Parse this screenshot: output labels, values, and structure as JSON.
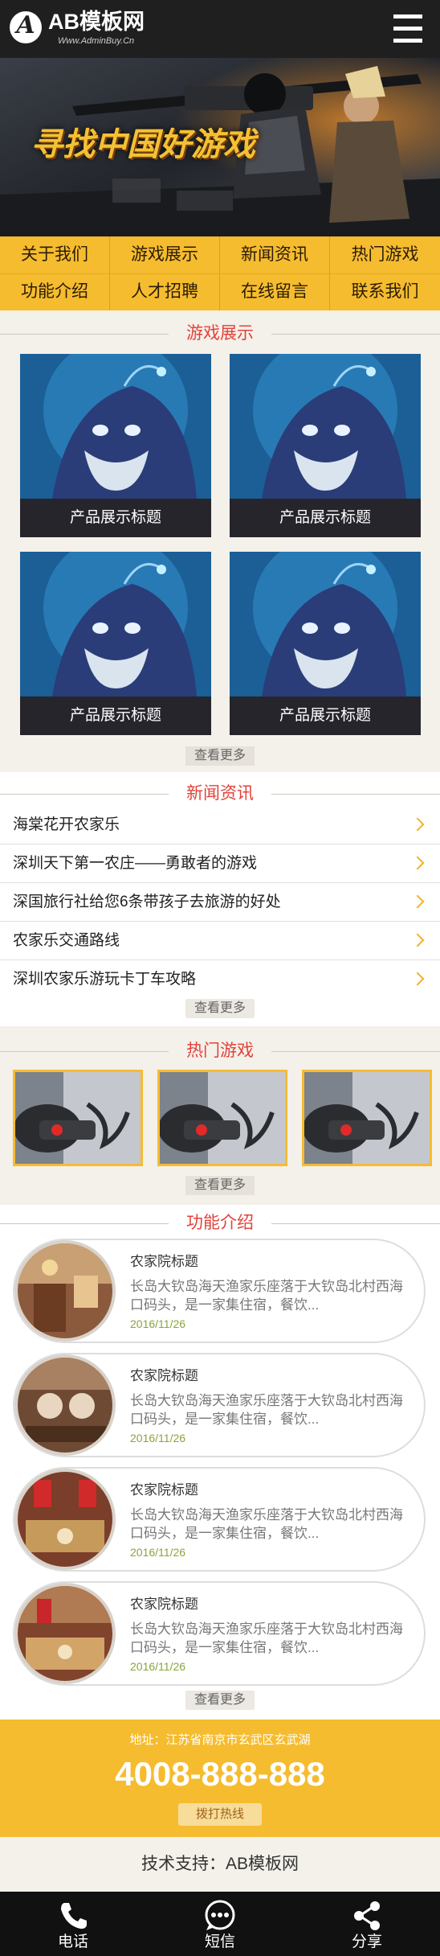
{
  "header": {
    "logo_letter": "A",
    "logo_title": "AB模板网",
    "logo_url": "Www.AdminBuy.Cn",
    "menu_icon": "hamburger-menu-icon"
  },
  "banner": {
    "slogan": "寻找中国好游戏"
  },
  "nav": {
    "items": [
      "关于我们",
      "游戏展示",
      "新闻资讯",
      "热门游戏",
      "功能介绍",
      "人才招聘",
      "在线留言",
      "联系我们"
    ]
  },
  "products": {
    "title": "游戏展示",
    "items": [
      {
        "caption": "产品展示标题"
      },
      {
        "caption": "产品展示标题"
      },
      {
        "caption": "产品展示标题"
      },
      {
        "caption": "产品展示标题"
      }
    ],
    "more": "查看更多"
  },
  "news": {
    "title": "新闻资讯",
    "items": [
      {
        "title": "海棠花开农家乐"
      },
      {
        "title": "深圳天下第一农庄——勇敢者的游戏"
      },
      {
        "title": "深国旅行社给您6条带孩子去旅游的好处"
      },
      {
        "title": "农家乐交通路线"
      },
      {
        "title": "深圳农家乐游玩卡丁车攻略"
      }
    ],
    "more": "查看更多"
  },
  "hot": {
    "title": "热门游戏",
    "more": "查看更多"
  },
  "features": {
    "title": "功能介绍",
    "items": [
      {
        "title": "农家院标题",
        "desc": "长岛大钦岛海天渔家乐座落于大钦岛北村西海口码头，是一家集住宿，餐饮...",
        "date": "2016/11/26"
      },
      {
        "title": "农家院标题",
        "desc": "长岛大钦岛海天渔家乐座落于大钦岛北村西海口码头，是一家集住宿，餐饮...",
        "date": "2016/11/26"
      },
      {
        "title": "农家院标题",
        "desc": "长岛大钦岛海天渔家乐座落于大钦岛北村西海口码头，是一家集住宿，餐饮...",
        "date": "2016/11/26"
      },
      {
        "title": "农家院标题",
        "desc": "长岛大钦岛海天渔家乐座落于大钦岛北村西海口码头，是一家集住宿，餐饮...",
        "date": "2016/11/26"
      }
    ],
    "more": "查看更多"
  },
  "contact": {
    "address": "地址：江苏省南京市玄武区玄武湖",
    "phone": "4008-888-888",
    "hotline_button": "拨打热线"
  },
  "footer": {
    "support": "技术支持：AB模板网"
  },
  "bottom_bar": {
    "items": [
      {
        "label": "电话",
        "icon": "phone-icon"
      },
      {
        "label": "短信",
        "icon": "sms-icon"
      },
      {
        "label": "分享",
        "icon": "share-icon"
      }
    ]
  },
  "colors": {
    "accent": "#f6bc2f",
    "section_title": "#e1433b",
    "header_bg": "#1f1f1f",
    "date": "#8aa53c"
  }
}
